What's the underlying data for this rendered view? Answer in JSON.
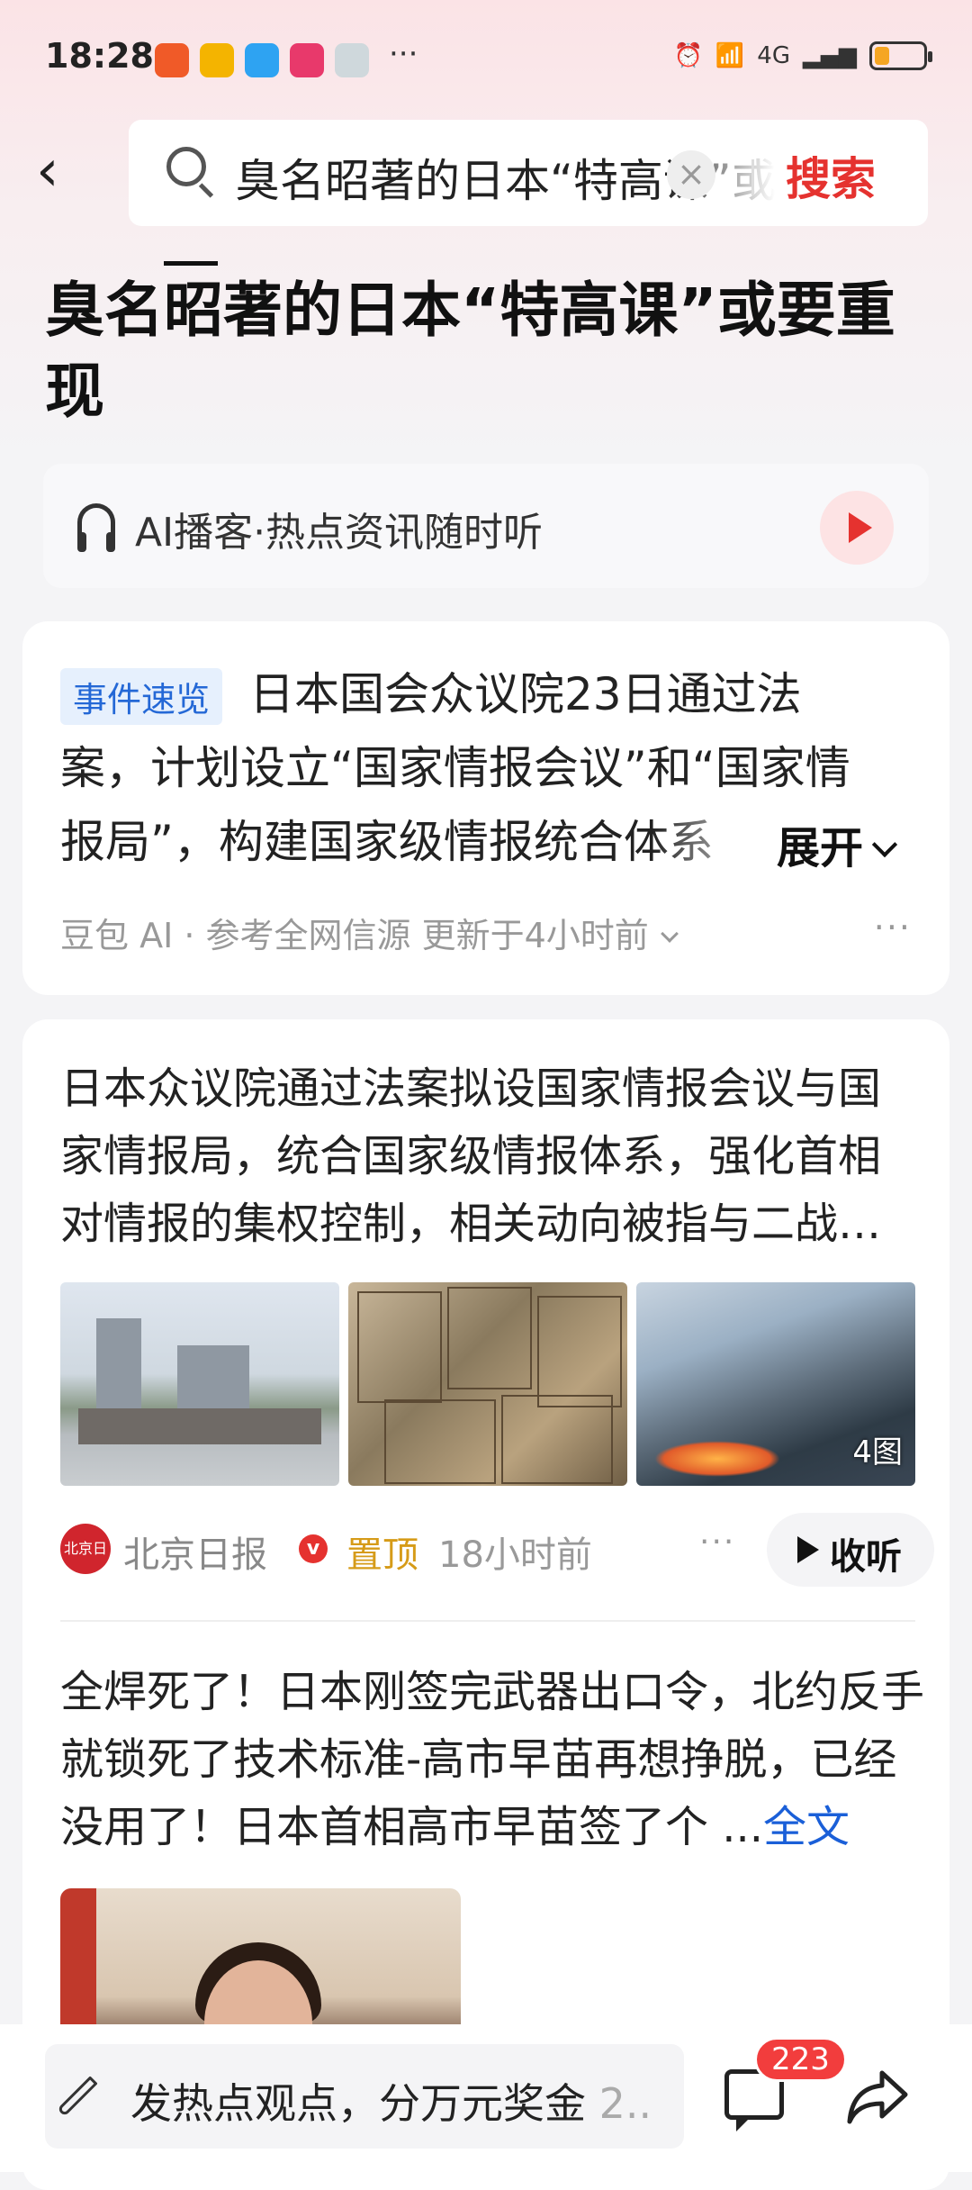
{
  "status_bar": {
    "time": "18:28",
    "network": "4G",
    "battery_level": 0.3,
    "app_icon_colors": [
      "#f05a28",
      "#f4b400",
      "#2ea3f2",
      "#e8396b",
      "#cfd8dc"
    ]
  },
  "search": {
    "query": "臭名昭著的日本“特高课”或要重现",
    "button_label": "搜索"
  },
  "article": {
    "title": "臭名昭著的日本“特高课”或要重现"
  },
  "podcast": {
    "label": "AI播客·热点资讯随时听"
  },
  "event_card": {
    "tag": "事件速览",
    "summary": "日本国会众议院23日通过法案，计划设立“国家情报会议”和“国家情报局”，构建国家级情报统合体系",
    "expand_label": "展开",
    "source": "豆包 AI · 参考全网信源 更新于4小时前",
    "more": "···"
  },
  "news": [
    {
      "text": "日本众议院通过法案拟设国家情报会议与国家情报局，统合国家级情报体系，强化首相对情报的集权控制，相关动向被指与二战…",
      "image_count_badge": "4图",
      "publisher": "北京日报",
      "publisher_logo_text": "北京日报",
      "verified_mark": "v",
      "pinned": "置顶",
      "time_ago": "18小时前",
      "more": "···",
      "listen_label": "收听"
    },
    {
      "text": "全焊死了！日本刚签完武器出口令，北约反手就锁死了技术标准-高市早苗再想挣脱，已经没用了！日本首相高市早苗签了个 ...",
      "full_text_label": "全文"
    }
  ],
  "bottom_bar": {
    "comment_placeholder": "发热点观点，分万元奖金",
    "comment_placeholder_suffix": "2..",
    "comment_count": "223"
  },
  "colors": {
    "accent_red": "#e5322f",
    "link_blue": "#1a5fd8",
    "pinned_gold": "#d69b18"
  }
}
